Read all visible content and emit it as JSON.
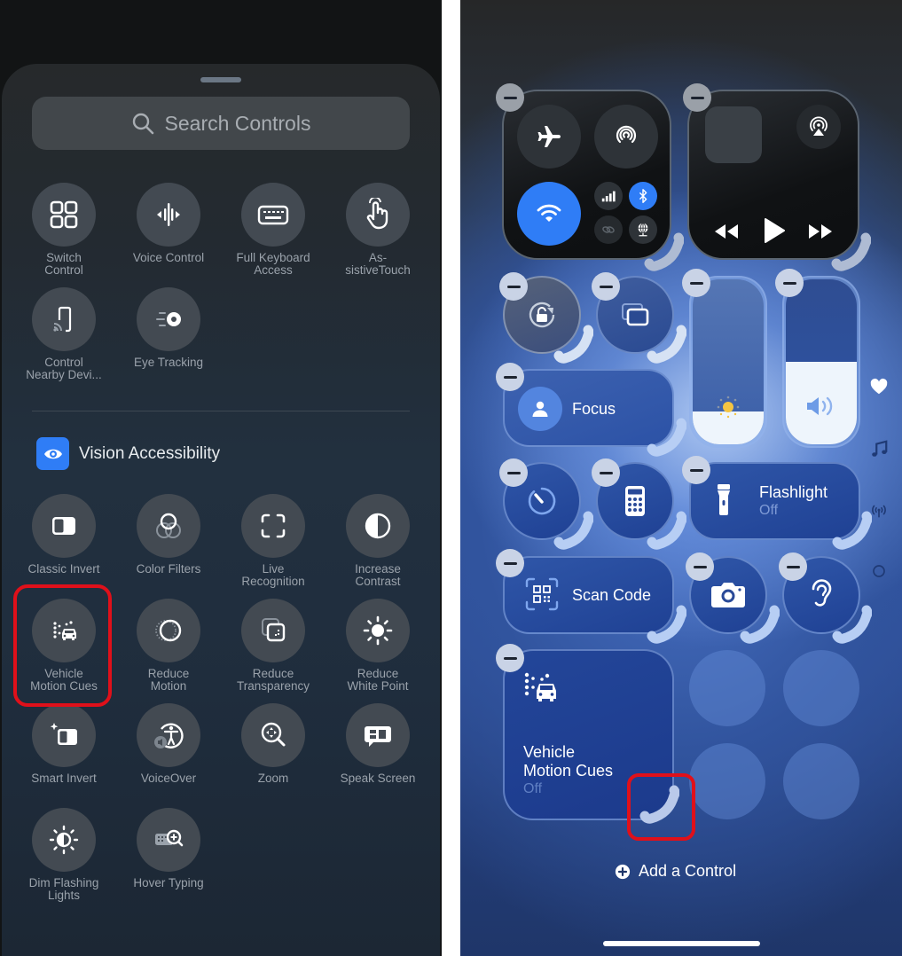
{
  "left_panel": {
    "search": {
      "placeholder": "Search Controls"
    },
    "top_controls": [
      {
        "label": "Switch\nControl",
        "icon": "switch-control-icon"
      },
      {
        "label": "Voice Control",
        "icon": "voice-control-icon"
      },
      {
        "label": "Full Keyboard\nAccess",
        "icon": "keyboard-icon"
      },
      {
        "label": "As-\nsistiveTouch",
        "icon": "assistive-touch-icon"
      },
      {
        "label": "Control\nNearby Devi...",
        "icon": "nearby-devices-icon"
      },
      {
        "label": "Eye Tracking",
        "icon": "eye-tracking-icon"
      }
    ],
    "section": {
      "title": "Vision Accessibility",
      "icon": "eye-icon",
      "color": "#2f7df6"
    },
    "vision_controls": [
      {
        "label": "Classic Invert",
        "icon": "classic-invert-icon"
      },
      {
        "label": "Color Filters",
        "icon": "color-filters-icon"
      },
      {
        "label": "Live\nRecognition",
        "icon": "live-recognition-icon"
      },
      {
        "label": "Increase\nContrast",
        "icon": "increase-contrast-icon"
      },
      {
        "label": "Vehicle\nMotion Cues",
        "icon": "vehicle-motion-cues-icon",
        "highlighted": true
      },
      {
        "label": "Reduce\nMotion",
        "icon": "reduce-motion-icon"
      },
      {
        "label": "Reduce\nTransparency",
        "icon": "reduce-transparency-icon"
      },
      {
        "label": "Reduce\nWhite Point",
        "icon": "reduce-white-point-icon"
      },
      {
        "label": "Smart Invert",
        "icon": "smart-invert-icon"
      },
      {
        "label": "VoiceOver",
        "icon": "voiceover-icon"
      },
      {
        "label": "Zoom",
        "icon": "zoom-icon"
      },
      {
        "label": "Speak Screen",
        "icon": "speak-screen-icon"
      },
      {
        "label": "Dim Flashing\nLights",
        "icon": "dim-flashing-lights-icon"
      },
      {
        "label": "Hover Typing",
        "icon": "hover-typing-icon"
      }
    ],
    "highlight_color": "#e0101a"
  },
  "right_panel": {
    "connectivity": {
      "wifi_on": true,
      "bluetooth_on": true,
      "accent": "#2f7df6"
    },
    "focus": {
      "label": "Focus"
    },
    "brightness": {
      "level": 0.2
    },
    "volume": {
      "level": 0.5
    },
    "flashlight": {
      "label": "Flashlight",
      "status": "Off"
    },
    "scan_code": {
      "label": "Scan Code"
    },
    "vehicle_motion_cues": {
      "label": "Vehicle\nMotion Cues",
      "status": "Off"
    },
    "side_pages": [
      "heart-icon",
      "music-note-icon",
      "antenna-icon",
      "circle-icon"
    ],
    "add_control": {
      "label": "Add a Control"
    },
    "highlight_color": "#e0101a"
  }
}
